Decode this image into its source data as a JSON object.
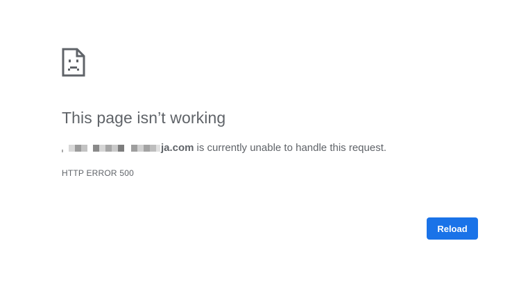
{
  "error": {
    "icon": "sad-page-icon",
    "title": "This page isn’t working",
    "domain_visible_suffix": "ja.com",
    "message": "is currently unable to handle this request.",
    "code": "HTTP ERROR 500"
  },
  "actions": {
    "reload_label": "Reload"
  },
  "colors": {
    "text": "#5f6368",
    "button": "#1a73e8",
    "button_text": "#ffffff",
    "background": "#ffffff"
  }
}
